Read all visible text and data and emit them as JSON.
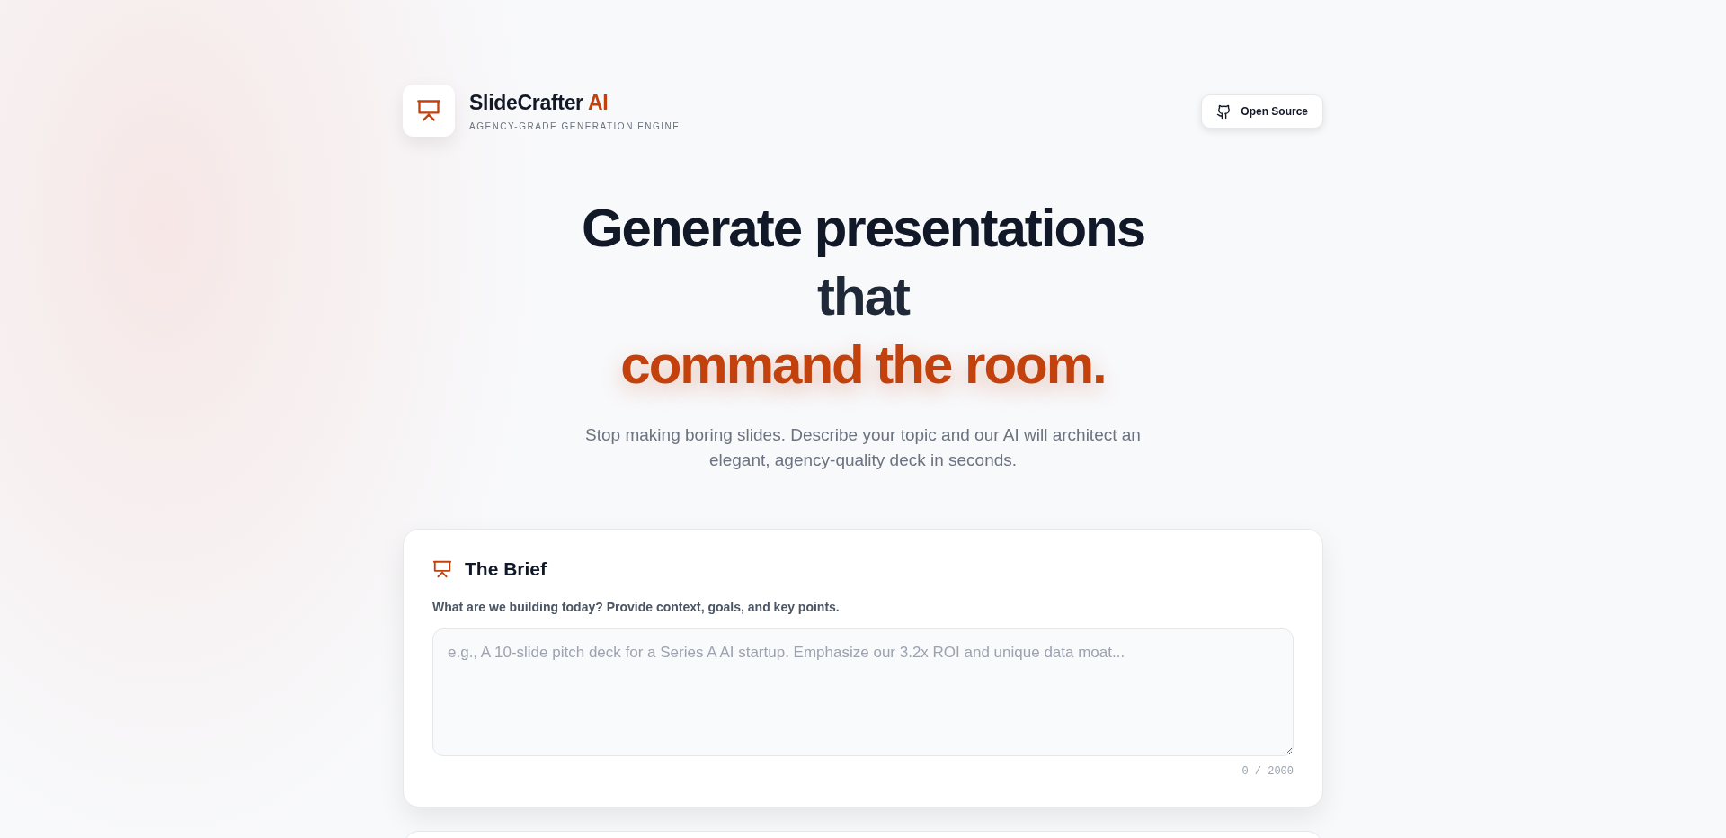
{
  "header": {
    "brand_name": "SlideCrafter",
    "brand_accent": "AI",
    "tagline": "AGENCY-GRADE GENERATION ENGINE",
    "action_button": "Open Source"
  },
  "hero": {
    "title_lines": [
      "Generate presentations",
      "that"
    ],
    "highlight": "command the room.",
    "subtitle": "Stop making boring slides. Describe your topic and our AI will architect an elegant, agency-quality deck in seconds."
  },
  "brief_card": {
    "title": "The Brief",
    "label": "What are we building today? Provide context, goals, and key points.",
    "placeholder": "e.g., A 10-slide pitch deck for a Series A AI startup. Emphasize our 3.2x ROI and unique data moat...",
    "counter": "0 / 2000"
  }
}
